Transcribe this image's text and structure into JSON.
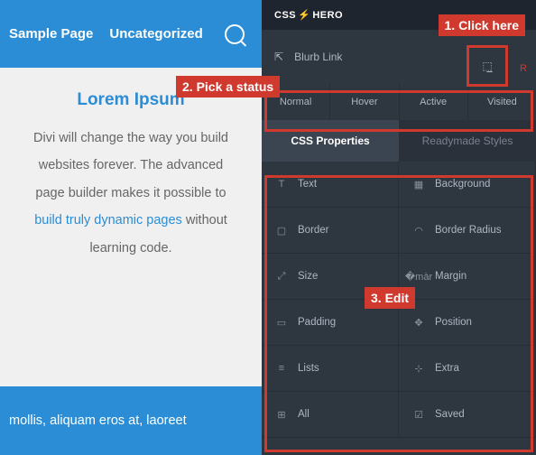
{
  "nav": {
    "item1": "Sample Page",
    "item2": "Uncategorized"
  },
  "content": {
    "title": "Lorem Ipsum",
    "line1": "Divi will change the way you build",
    "line2": "websites forever. The advanced",
    "line3": "page builder makes it possible to",
    "link": "build truly dynamic pages",
    "line4_rest": " without",
    "line5": "learning code."
  },
  "bottom_text": "mollis, aliquam eros at, laoreet",
  "hero": {
    "brand_a": "CSS",
    "brand_b": "HERO"
  },
  "blurb": {
    "label": "Blurb Link",
    "r": "R"
  },
  "states": {
    "s1": "Normal",
    "s2": "Hover",
    "s3": "Active",
    "s4": "Visited"
  },
  "tabs": {
    "props": "CSS Properties",
    "ready": "Readymade Styles"
  },
  "props": {
    "text": "Text",
    "background": "Background",
    "border": "Border",
    "border_radius": "Border Radius",
    "size": "Size",
    "margin": "Margin",
    "padding": "Padding",
    "position": "Position",
    "lists": "Lists",
    "extra": "Extra",
    "all": "All",
    "saved": "Saved"
  },
  "callouts": {
    "c1": "1. Click here",
    "c2": "2. Pick a status",
    "c3": "3. Edit"
  }
}
